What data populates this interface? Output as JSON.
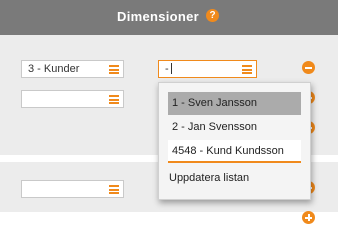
{
  "header": {
    "title": "Dimensioner",
    "help_icon": "?"
  },
  "fields": {
    "row1_left_value": "3 - Kunder",
    "row1_right_value": "-",
    "row2_left_value": "",
    "row3_left_value": ""
  },
  "dropdown": {
    "options": [
      "1 - Sven Jansson",
      "2 - Jan Svensson",
      "4548 - Kund Kundsson"
    ],
    "refresh_label": "Uppdatera listan"
  },
  "colors": {
    "accent": "#f08a1c",
    "header_bg": "#7a7a7a",
    "band_bg": "#ececec",
    "selected_option_bg": "#ababab"
  }
}
